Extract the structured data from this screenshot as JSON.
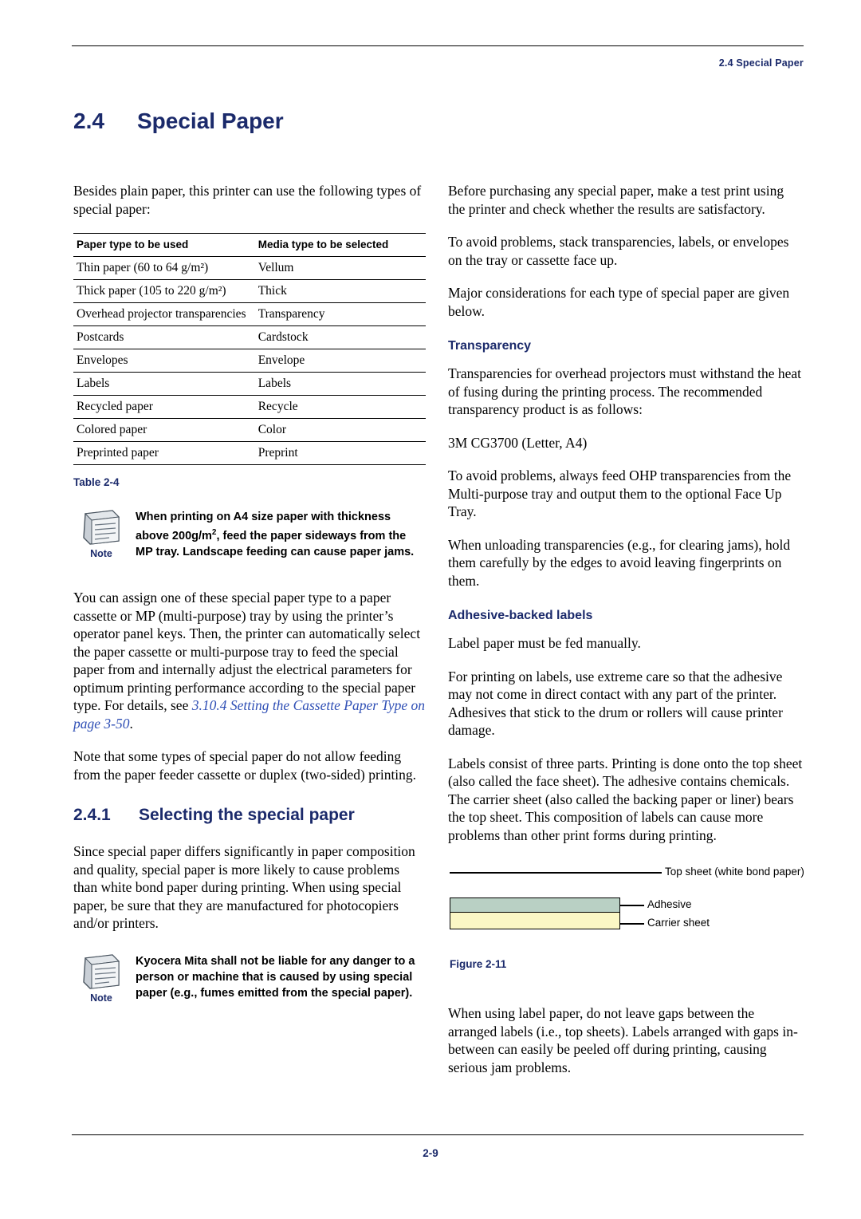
{
  "header": {
    "running_head": "2.4 Special Paper"
  },
  "chapter": {
    "number": "2.4",
    "title": "Special Paper"
  },
  "left": {
    "intro": "Besides plain paper, this printer can use the following types of special paper:",
    "table": {
      "headers": [
        "Paper type to be used",
        "Media type to be selected"
      ],
      "rows": [
        [
          "Thin paper (60 to 64 g/m²)",
          "Vellum"
        ],
        [
          "Thick paper (105 to 220 g/m²)",
          "Thick"
        ],
        [
          "Overhead projector transparencies",
          "Transparency"
        ],
        [
          "Postcards",
          "Cardstock"
        ],
        [
          "Envelopes",
          "Envelope"
        ],
        [
          "Labels",
          "Labels"
        ],
        [
          "Recycled paper",
          "Recycle"
        ],
        [
          "Colored paper",
          "Color"
        ],
        [
          "Preprinted paper",
          "Preprint"
        ]
      ],
      "caption": "Table 2-4"
    },
    "note1": {
      "label": "Note",
      "text_part1": "When printing on A4 size paper with thickness above 200g/m",
      "text_sup": "2",
      "text_part2": ", feed the paper sideways from the MP tray. Landscape feeding can cause paper jams."
    },
    "para_assign_1": "You can assign one of these special paper type to a paper cassette or MP (multi-purpose) tray by using the printer’s operator panel keys. Then, the printer can automatically select the paper cassette or multi-purpose tray to feed the special paper from and internally adjust the electrical parameters for optimum printing performance according to the special paper type. For details, see ",
    "para_assign_link": "3.10.4 Setting the Cassette Paper Type on page 3-50",
    "para_assign_end": ".",
    "para_note_feeding": "Note that some types of special paper do not allow feeding from the paper feeder cassette or duplex (two-sided) printing.",
    "section": {
      "number": "2.4.1",
      "title": "Selecting the special paper"
    },
    "para_since": "Since special paper differs significantly in paper composition and quality, special paper is more likely to cause problems than white bond paper during printing. When using special paper, be sure that they are manufactured for photocopiers and/or printers.",
    "note2": {
      "label": "Note",
      "text": "Kyocera Mita shall not be liable for any danger to a person or machine that is caused by using special paper (e.g., fumes emitted from the special paper)."
    }
  },
  "right": {
    "para_before": "Before purchasing any special paper, make a test print using the printer and check whether the results are satisfactory.",
    "para_avoid": "To avoid problems, stack transparencies, labels, or envelopes on the tray or cassette face up.",
    "para_major": "Major considerations for each type of special paper are given below.",
    "transparency_heading": "Transparency",
    "para_transparency_1": "Transparencies for overhead projectors must withstand the heat of fusing during the printing process. The recommended transparency product is as follows:",
    "product": "3M CG3700 (Letter, A4)",
    "para_transparency_2": "To avoid problems, always feed OHP transparencies from the Multi-purpose tray and output them to the optional Face Up Tray.",
    "para_transparency_3": "When unloading transparencies (e.g., for clearing jams), hold them carefully by the edges to avoid leaving fingerprints on them.",
    "labels_heading": "Adhesive-backed labels",
    "para_labels_1": "Label paper must be fed manually.",
    "para_labels_2": "For printing on labels, use extreme care so that the adhesive may not come in direct  contact with any part of the printer. Adhesives that stick to the drum or rollers will cause printer damage.",
    "para_labels_3": "Labels consist of three parts. Printing is done onto the top sheet (also called the face sheet). The adhesive contains chemicals. The carrier sheet (also called the backing paper or liner) bears the top sheet. This composition of labels can cause more problems than other print forms during printing.",
    "figure": {
      "label_top": "Top sheet (white bond paper)",
      "label_adhesive": "Adhesive",
      "label_carrier": "Carrier sheet",
      "caption": "Figure 2-11"
    },
    "para_gaps": "When using label paper, do not leave gaps between the arranged labels (i.e., top sheets). Labels arranged with gaps in-between can easily be peeled off during printing, causing serious jam problems."
  },
  "footer": {
    "page_number": "2-9"
  }
}
